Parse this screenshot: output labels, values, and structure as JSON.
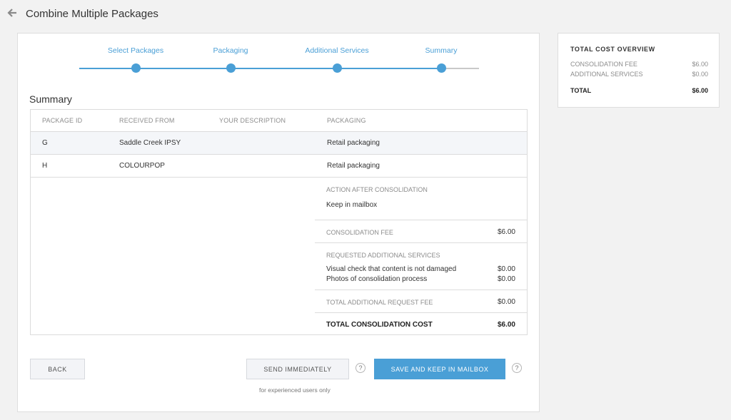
{
  "header": {
    "title": "Combine Multiple Packages",
    "back_icon": "arrow-left-icon"
  },
  "stepper": {
    "steps": [
      {
        "label": "Select Packages"
      },
      {
        "label": "Packaging"
      },
      {
        "label": "Additional Services"
      },
      {
        "label": "Summary"
      }
    ],
    "current_step": 4,
    "colors": {
      "active": "#4a9fd6",
      "inactive": "#c9c9c9"
    }
  },
  "summary": {
    "title": "Summary",
    "columns": [
      "PACKAGE ID",
      "RECEIVED FROM",
      "YOUR DESCRIPTION",
      "PACKAGING"
    ],
    "rows": [
      {
        "id": "G",
        "from": "Saddle Creek IPSY",
        "description": "",
        "packaging": "Retail packaging"
      },
      {
        "id": "H",
        "from": "COLOURPOP",
        "description": "",
        "packaging": "Retail packaging"
      }
    ],
    "action_label": "ACTION AFTER CONSOLIDATION",
    "action_value": "Keep in mailbox",
    "consolidation_fee_label": "CONSOLIDATION FEE",
    "consolidation_fee": "$6.00",
    "requested_services_label": "REQUESTED ADDITIONAL SERVICES",
    "services": [
      {
        "name": "Visual check that content is not damaged",
        "price": "$0.00"
      },
      {
        "name": "Photos of consolidation process",
        "price": "$0.00"
      }
    ],
    "total_additional_label": "TOTAL ADDITIONAL REQUEST FEE",
    "total_additional": "$0.00",
    "total_cost_label": "TOTAL CONSOLIDATION COST",
    "total_cost": "$6.00"
  },
  "actions": {
    "back": "BACK",
    "send": "SEND IMMEDIATELY",
    "save": "SAVE AND KEEP IN MAILBOX",
    "help": "?",
    "note": "for experienced users only"
  },
  "overview": {
    "title": "TOTAL COST OVERVIEW",
    "consolidation_label": "CONSOLIDATION FEE",
    "consolidation_amount": "$6.00",
    "additional_label": "ADDITIONAL SERVICES",
    "additional_amount": "$0.00",
    "total_label": "TOTAL",
    "total_amount": "$6.00"
  }
}
